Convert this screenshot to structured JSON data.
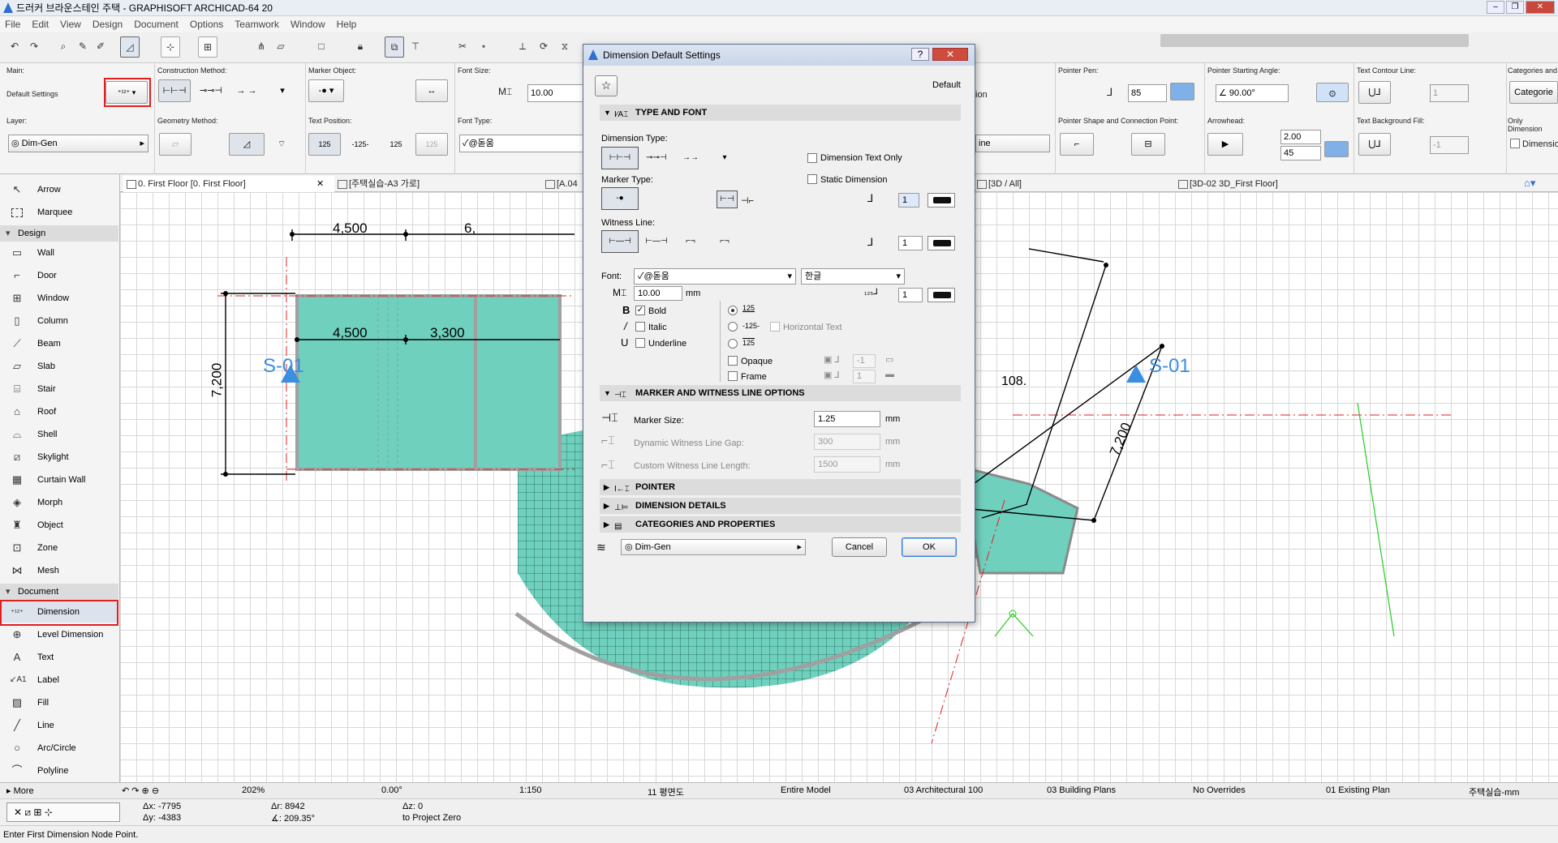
{
  "window": {
    "title": "드러커 브라운스테인 주택 - GRAPHISOFT ARCHICAD-64 20"
  },
  "menu": [
    "File",
    "Edit",
    "View",
    "Design",
    "Document",
    "Options",
    "Teamwork",
    "Window",
    "Help"
  ],
  "infobox": {
    "main_label": "Main:",
    "default_settings": "Default Settings",
    "construction_method_label": "Construction Method:",
    "marker_object_label": "Marker Object:",
    "font_size_label": "Font Size:",
    "font_size_value": "10.00",
    "pointer_pen_label": "Pointer Pen:",
    "pointer_pen_value": "85",
    "pointer_angle_label": "Pointer Starting Angle:",
    "pointer_angle_value": "90.00°",
    "text_contour_label": "Text Contour Line:",
    "text_contour_value": "1",
    "categories_label": "Categories and",
    "categories_btn": "Categorie",
    "layer_label": "Layer:",
    "layer_value": "Dim-Gen",
    "geometry_label": "Geometry Method:",
    "text_position_label": "Text Position:",
    "text_pos_a": "125",
    "text_pos_b": "-125-",
    "text_pos_c": "125",
    "text_pos_d": "125",
    "font_type_label": "Font Type:",
    "font_type_value": "✓@돋움",
    "ine_partial": "ine",
    "ion_partial": "ion",
    "pointer_shape_label": "Pointer Shape and Connection Point:",
    "arrowhead_label": "Arrowhead:",
    "arrowhead_size": "2.00",
    "arrowhead_angle": "45",
    "text_bg_label": "Text Background Fill:",
    "text_bg_value": "-1",
    "only_dim_label": "Only Dimension",
    "only_dim_cb": "Dimensio"
  },
  "toolbox": {
    "items_top": [
      {
        "icon": "arrow-icon",
        "label": "Arrow"
      },
      {
        "icon": "marquee-icon",
        "label": "Marquee"
      }
    ],
    "design_label": "Design",
    "design": [
      "Wall",
      "Door",
      "Window",
      "Column",
      "Beam",
      "Slab",
      "Stair",
      "Roof",
      "Shell",
      "Skylight",
      "Curtain Wall",
      "Morph",
      "Object",
      "Zone",
      "Mesh"
    ],
    "document_label": "Document",
    "document": [
      "Dimension",
      "Level Dimension",
      "Text",
      "Label",
      "Fill",
      "Line",
      "Arc/Circle",
      "Polyline"
    ],
    "more": "More"
  },
  "tabs": [
    "0. First Floor [0. First Floor]",
    "[주택실습-A3 가로]",
    "[A.04",
    "[3D / All]",
    "[3D-02 3D_First Floor]"
  ],
  "drawing": {
    "dim_top_a": "4,500",
    "dim_top_b": "6,",
    "dim_in_a": "4,500",
    "dim_in_b": "3,300",
    "dim_left": "7,200",
    "dim_right": "7,200",
    "angle": "108.",
    "section_left": "S-01",
    "section_right": "S-01"
  },
  "statusbar": {
    "zoom": "202%",
    "angle": "0.00°",
    "scale": "1:150",
    "floor": "11 평면도",
    "model": "Entire Model",
    "pen_set": "03 Architectural 100",
    "mvo": "03 Building Plans",
    "overrides": "No Overrides",
    "renovation": "01 Existing Plan",
    "dim_std": "주택실습-mm"
  },
  "coords": {
    "dx": "Δx: -7795",
    "dy": "Δy: -4383",
    "dr": "Δr: 8942",
    "da": "∡: 209.35°",
    "dz": "Δz: 0",
    "to": "to Project Zero"
  },
  "prompt": "Enter First Dimension Node Point.",
  "dialog": {
    "title": "Dimension Default Settings",
    "default_label": "Default",
    "sec_type_font": "TYPE AND FONT",
    "dim_type_label": "Dimension Type:",
    "dim_text_only": "Dimension Text Only",
    "static_dim": "Static Dimension",
    "marker_type_label": "Marker Type:",
    "marker_pen": "1",
    "witness_label": "Witness Line:",
    "witness_pen": "1",
    "font_label": "Font:",
    "font_value": "✓@돋움",
    "script_value": "한글",
    "size_value": "10.00",
    "size_unit": "mm",
    "text_pen": "1",
    "bold": "Bold",
    "italic": "Italic",
    "underline": "Underline",
    "pos_a": "125",
    "pos_b": "-125-",
    "pos_c": "125",
    "horizontal_text": "Horizontal Text",
    "opaque": "Opaque",
    "frame": "Frame",
    "opaque_val": "-1",
    "frame_val": "1",
    "sec_marker": "MARKER AND WITNESS LINE OPTIONS",
    "marker_size_label": "Marker Size:",
    "marker_size_value": "1.25",
    "mm": "mm",
    "gap_label": "Dynamic Witness Line Gap:",
    "gap_value": "300",
    "custom_label": "Custom Witness Line Length:",
    "custom_value": "1500",
    "sec_pointer": "POINTER",
    "sec_details": "DIMENSION DETAILS",
    "sec_categories": "CATEGORIES AND PROPERTIES",
    "layer_value": "Dim-Gen",
    "cancel": "Cancel",
    "ok": "OK"
  },
  "colors": {
    "zone_fill": "#6fd0bd",
    "wall": "#a0a0a0",
    "dim_line": "#000000",
    "section": "#3a8fe0",
    "red_line": "#e02020",
    "highlight": "#e02020"
  }
}
